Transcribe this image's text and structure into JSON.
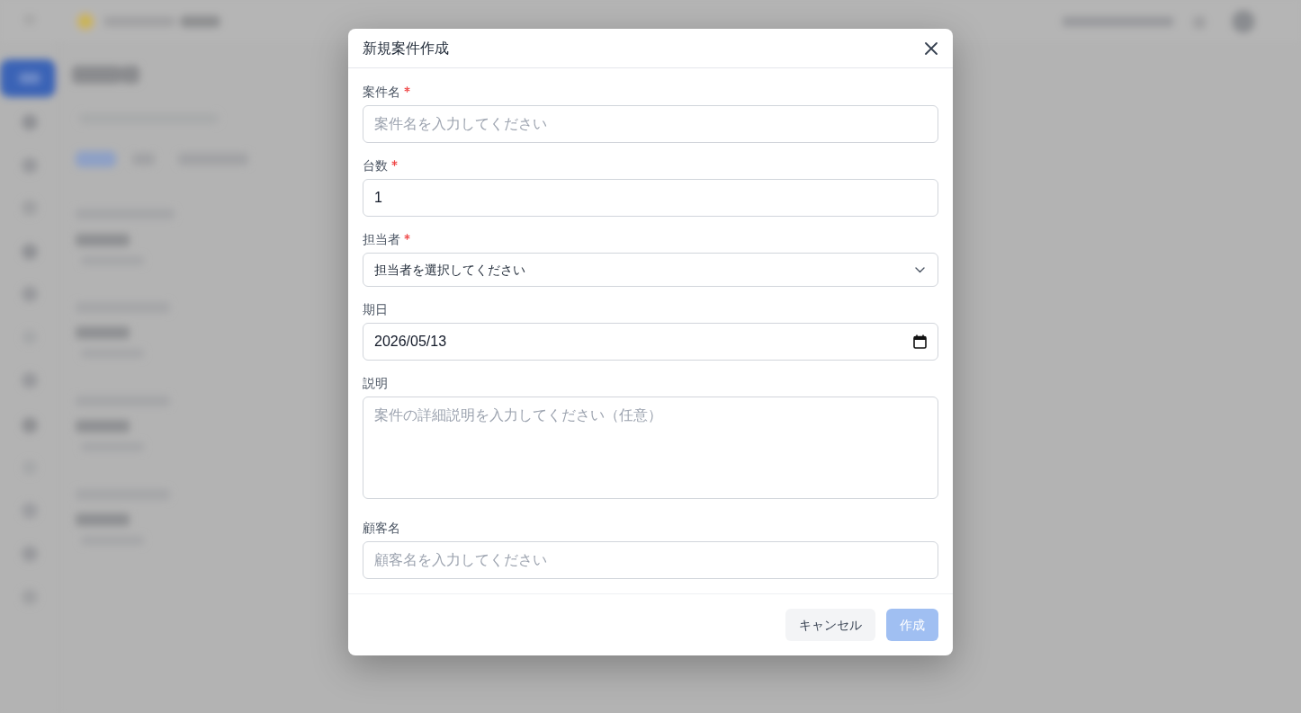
{
  "dialog": {
    "title": "新規案件作成",
    "fields": [
      {
        "kind": "text",
        "label": "案件名",
        "required": true,
        "placeholder": "案件名を入力してください"
      },
      {
        "kind": "number",
        "label": "台数",
        "required": true,
        "value": "1"
      },
      {
        "kind": "select",
        "label": "担当者",
        "required": true,
        "value": "担当者を選択してください"
      },
      {
        "kind": "date",
        "label": "期日",
        "required": false,
        "value": "2026/05/13"
      },
      {
        "kind": "textarea",
        "label": "説明",
        "required": false,
        "placeholder": "案件の詳細説明を入力してください（任意）"
      },
      {
        "kind": "text",
        "label": "顧客名",
        "required": false,
        "placeholder": "顧客名を入力してください"
      }
    ],
    "buttons": [
      {
        "kind": "secondary",
        "label": "キャンセル",
        "disabled": false
      },
      {
        "kind": "primary",
        "label": "作成",
        "disabled": true
      }
    ]
  }
}
